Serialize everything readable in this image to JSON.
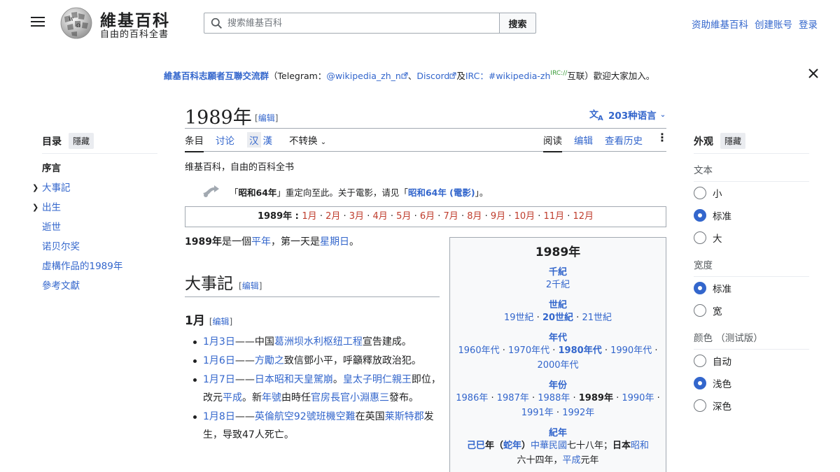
{
  "header": {
    "menu_icon": "hamburger-icon",
    "logo_icon": "wikipedia-globe-icon",
    "site_title": "維基百科",
    "site_tagline": "自由的百科全書",
    "search_placeholder": "搜索維基百科",
    "search_button": "搜索",
    "user_links": [
      "资助維基百科",
      "创建账号",
      "登录"
    ]
  },
  "banner": {
    "group": "維基百科志願者互聯交流群",
    "open_paren": "（",
    "telegram_label": "Telegram：",
    "telegram_link": "@wikipedia_zh_n",
    "sep": "、",
    "discord": "Discord",
    "and": "及",
    "irc_label": "IRC：",
    "irc_link": "#wikipedia-zh",
    "irc_sup": "IRC://",
    "tail": "互联）歡迎大家加入。",
    "close_icon": "close-icon"
  },
  "toc": {
    "title": "目录",
    "hide": "隱藏",
    "items": [
      "序言",
      "大事記",
      "出生",
      "逝世",
      "诺贝尔奖",
      "虛構作品的1989年",
      "參考文獻"
    ]
  },
  "title": {
    "text": "1989年",
    "edit": "编辑",
    "languages": "203种语言"
  },
  "tabs": {
    "left": [
      "条目",
      "讨论"
    ],
    "variants": [
      "汉",
      "漢"
    ],
    "convert": "不转换",
    "right": [
      "阅读",
      "编辑",
      "查看历史"
    ]
  },
  "content": {
    "tagline": "维基百科，自由的百科全书",
    "hatnote": {
      "q1": "「",
      "bold": "昭和64年",
      "mid": "」重定向至此。关于電影，请见「",
      "link": "昭和64年 (電影)",
      "end": "」。"
    },
    "months_label": "1989年",
    "months": [
      "1月",
      "2月",
      "3月",
      "4月",
      "5月",
      "6月",
      "7月",
      "8月",
      "9月",
      "10月",
      "11月",
      "12月"
    ],
    "intro": {
      "bold": "1989年",
      "t1": "是一個",
      "l1": "平年",
      "t2": "，第一天是",
      "l2": "星期日",
      "t3": "。"
    },
    "h2": "大事記",
    "h2_edit": "编辑",
    "h3": "1月",
    "h3_edit": "编辑"
  },
  "events": [
    {
      "date": "1月3日",
      "parts": [
        [
          "——中国",
          false
        ],
        [
          "葛洲坝水利枢纽工程",
          true
        ],
        [
          "宣告建成。",
          false
        ]
      ]
    },
    {
      "date": "1月6日",
      "parts": [
        [
          "——",
          false
        ],
        [
          "方勵之",
          true
        ],
        [
          "致信鄧小平，呼籲釋放政治犯。",
          false
        ]
      ]
    },
    {
      "date": "1月7日",
      "parts": [
        [
          "——",
          false
        ],
        [
          "日本昭和天皇駕崩",
          true
        ],
        [
          "。",
          false
        ],
        [
          "皇太子明仁親王",
          true
        ],
        [
          "即位，改元",
          false
        ],
        [
          "平成",
          true
        ],
        [
          "。新",
          false
        ],
        [
          "年號",
          true
        ],
        [
          "由時任",
          false
        ],
        [
          "官房長官",
          true
        ],
        [
          "小淵惠三",
          true
        ],
        [
          "發布。",
          false
        ]
      ]
    },
    {
      "date": "1月8日",
      "parts": [
        [
          "——",
          false
        ],
        [
          "英倫航空92號班機空難",
          true
        ],
        [
          "在英国",
          false
        ],
        [
          "莱斯特郡",
          true
        ],
        [
          "发生，导致47人死亡。",
          false
        ]
      ]
    }
  ],
  "infobox": {
    "title": "1989年",
    "sections": [
      {
        "head": "千紀",
        "rows": [
          [
            [
              "2千紀",
              "l"
            ]
          ]
        ]
      },
      {
        "head": "世紀",
        "rows": [
          [
            [
              "19世紀",
              "l"
            ],
            [
              " · ",
              "t"
            ],
            [
              "20世紀",
              "lb"
            ],
            [
              " · ",
              "t"
            ],
            [
              "21世紀",
              "l"
            ]
          ]
        ]
      },
      {
        "head": "年代",
        "rows": [
          [
            [
              "1960年代",
              "l"
            ],
            [
              " · ",
              "t"
            ],
            [
              "1970年代",
              "l"
            ],
            [
              " · ",
              "t"
            ],
            [
              "1980年代",
              "lb"
            ],
            [
              " · ",
              "t"
            ],
            [
              "1990年代",
              "l"
            ],
            [
              " ·",
              "t"
            ]
          ],
          [
            [
              "2000年代",
              "l"
            ]
          ]
        ]
      },
      {
        "head": "年份",
        "rows": [
          [
            [
              "1986年",
              "l"
            ],
            [
              " · ",
              "t"
            ],
            [
              "1987年",
              "l"
            ],
            [
              " · ",
              "t"
            ],
            [
              "1988年",
              "l"
            ],
            [
              " · ",
              "t"
            ],
            [
              "1989年",
              "b"
            ],
            [
              " · ",
              "t"
            ],
            [
              "1990年",
              "l"
            ],
            [
              " ·",
              "t"
            ]
          ],
          [
            [
              "1991年",
              "l"
            ],
            [
              " · ",
              "t"
            ],
            [
              "1992年",
              "l"
            ]
          ]
        ]
      },
      {
        "head": "紀年",
        "rows": [
          [
            [
              "己巳",
              "lb"
            ],
            [
              "年（",
              "b"
            ],
            [
              "蛇年",
              "lb"
            ],
            [
              "）",
              "b"
            ],
            [
              "中華民國",
              "l"
            ],
            [
              "七十八年；",
              "t"
            ],
            [
              "日本",
              "b"
            ],
            [
              "昭和",
              "l"
            ]
          ],
          [
            [
              "六十四年，",
              "t"
            ],
            [
              "平成",
              "l"
            ],
            [
              "元年",
              "t"
            ]
          ]
        ]
      }
    ]
  },
  "appearance": {
    "title": "外观",
    "hide": "隱藏",
    "text_label": "文本",
    "text_opts": [
      "小",
      "标准",
      "大"
    ],
    "text_selected": 1,
    "width_label": "宽度",
    "width_opts": [
      "标准",
      "宽"
    ],
    "width_selected": 0,
    "color_label": "颜色 （测试版）",
    "color_opts": [
      "自动",
      "浅色",
      "深色"
    ],
    "color_selected": 1
  }
}
